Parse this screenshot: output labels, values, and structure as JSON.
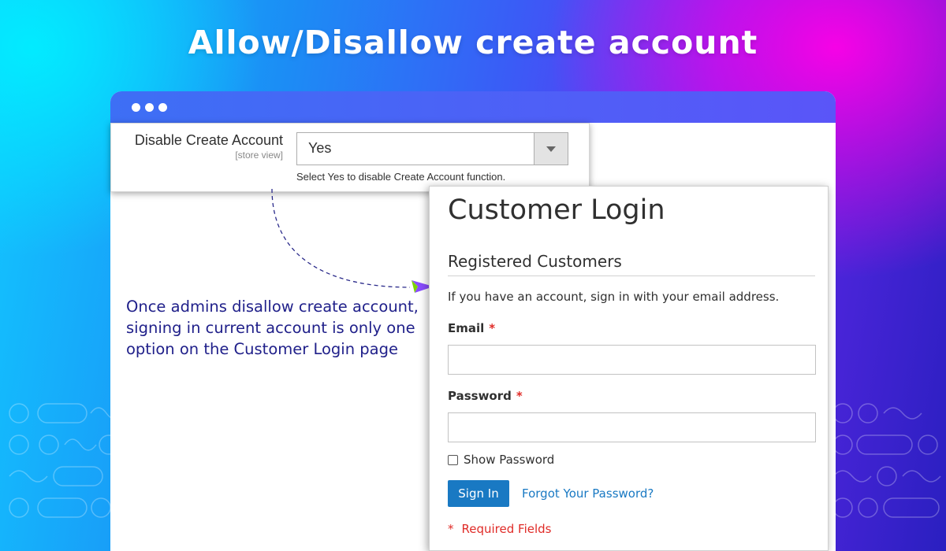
{
  "headline": "Allow/Disallow create account",
  "config": {
    "label": "Disable Create Account",
    "scope": "[store view]",
    "selected_value": "Yes",
    "note": "Select Yes to disable Create Account function."
  },
  "callout": {
    "text": "Once admins disallow create account, signing in current account is only one option on the Customer Login page"
  },
  "login": {
    "title": "Customer Login",
    "section_title": "Registered Customers",
    "intro": "If you have an account, sign in with your email address.",
    "email_label": "Email",
    "email_value": "",
    "password_label": "Password",
    "password_value": "",
    "required_mark": "*",
    "show_password_label": "Show Password",
    "signin_label": "Sign In",
    "forgot_label": "Forgot Your Password?",
    "required_fields_label": "Required Fields"
  },
  "colors": {
    "window_bar": "#4a63f6",
    "primary_button": "#1979c3",
    "link": "#1979c3",
    "required": "#e02b27",
    "callout_text": "#20208a"
  },
  "icons": {
    "window_controls": "three-dots-icon",
    "select_arrow": "chevron-down-icon",
    "pointer": "paper-plane-icon"
  }
}
